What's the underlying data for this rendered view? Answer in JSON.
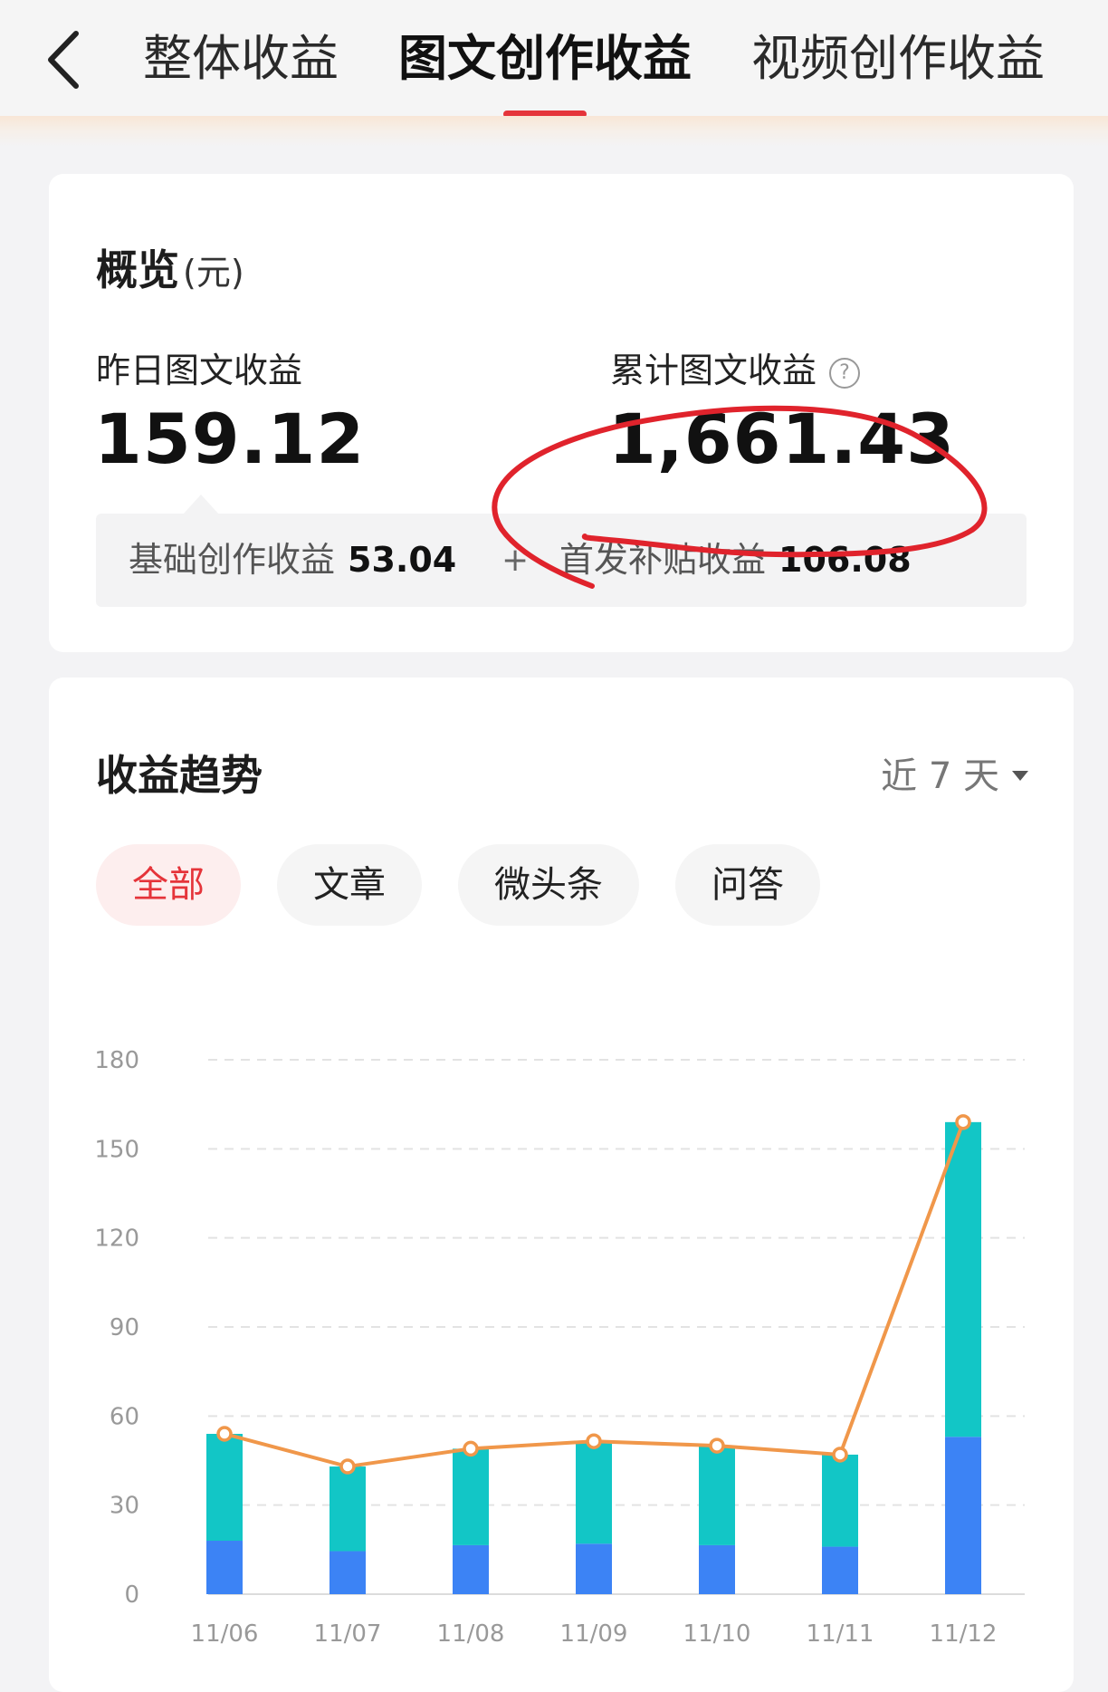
{
  "header": {
    "tabs": [
      {
        "label": "整体收益",
        "active": false
      },
      {
        "label": "图文创作收益",
        "active": true
      },
      {
        "label": "视频创作收益",
        "active": false
      }
    ]
  },
  "overview": {
    "title": "概览",
    "unit": "(元)",
    "yesterday": {
      "label": "昨日图文收益",
      "value": "159.12"
    },
    "total": {
      "label": "累计图文收益",
      "value": "1,661.43"
    },
    "breakdown": {
      "base": {
        "label": "基础创作收益",
        "value": "53.04"
      },
      "plus": "+",
      "subsidy": {
        "label": "首发补贴收益",
        "value": "106.08"
      }
    }
  },
  "trend": {
    "title": "收益趋势",
    "range": "近 7 天",
    "filters": [
      "全部",
      "文章",
      "微头条",
      "问答"
    ],
    "active_filter": 0
  },
  "colors": {
    "accent": "#e5343a",
    "bar_base": "#3c83f5",
    "bar_subsidy": "#12c6c6",
    "line": "#f0974a"
  },
  "chart_data": {
    "type": "bar",
    "stacked": true,
    "categories": [
      "11/06",
      "11/07",
      "11/08",
      "11/09",
      "11/10",
      "11/11",
      "11/12"
    ],
    "series": [
      {
        "type": "bar",
        "values": [
          18,
          14.5,
          16.5,
          17,
          16.5,
          16,
          53
        ]
      },
      {
        "type": "bar",
        "values": [
          36,
          28.5,
          32.5,
          34.5,
          33.5,
          31,
          106
        ]
      },
      {
        "type": "line",
        "values": [
          54,
          43,
          49,
          51.5,
          50,
          47,
          159
        ]
      }
    ],
    "ylim": [
      0,
      180
    ],
    "yticks": [
      0,
      30,
      60,
      90,
      120,
      150,
      180
    ],
    "grid": true
  }
}
